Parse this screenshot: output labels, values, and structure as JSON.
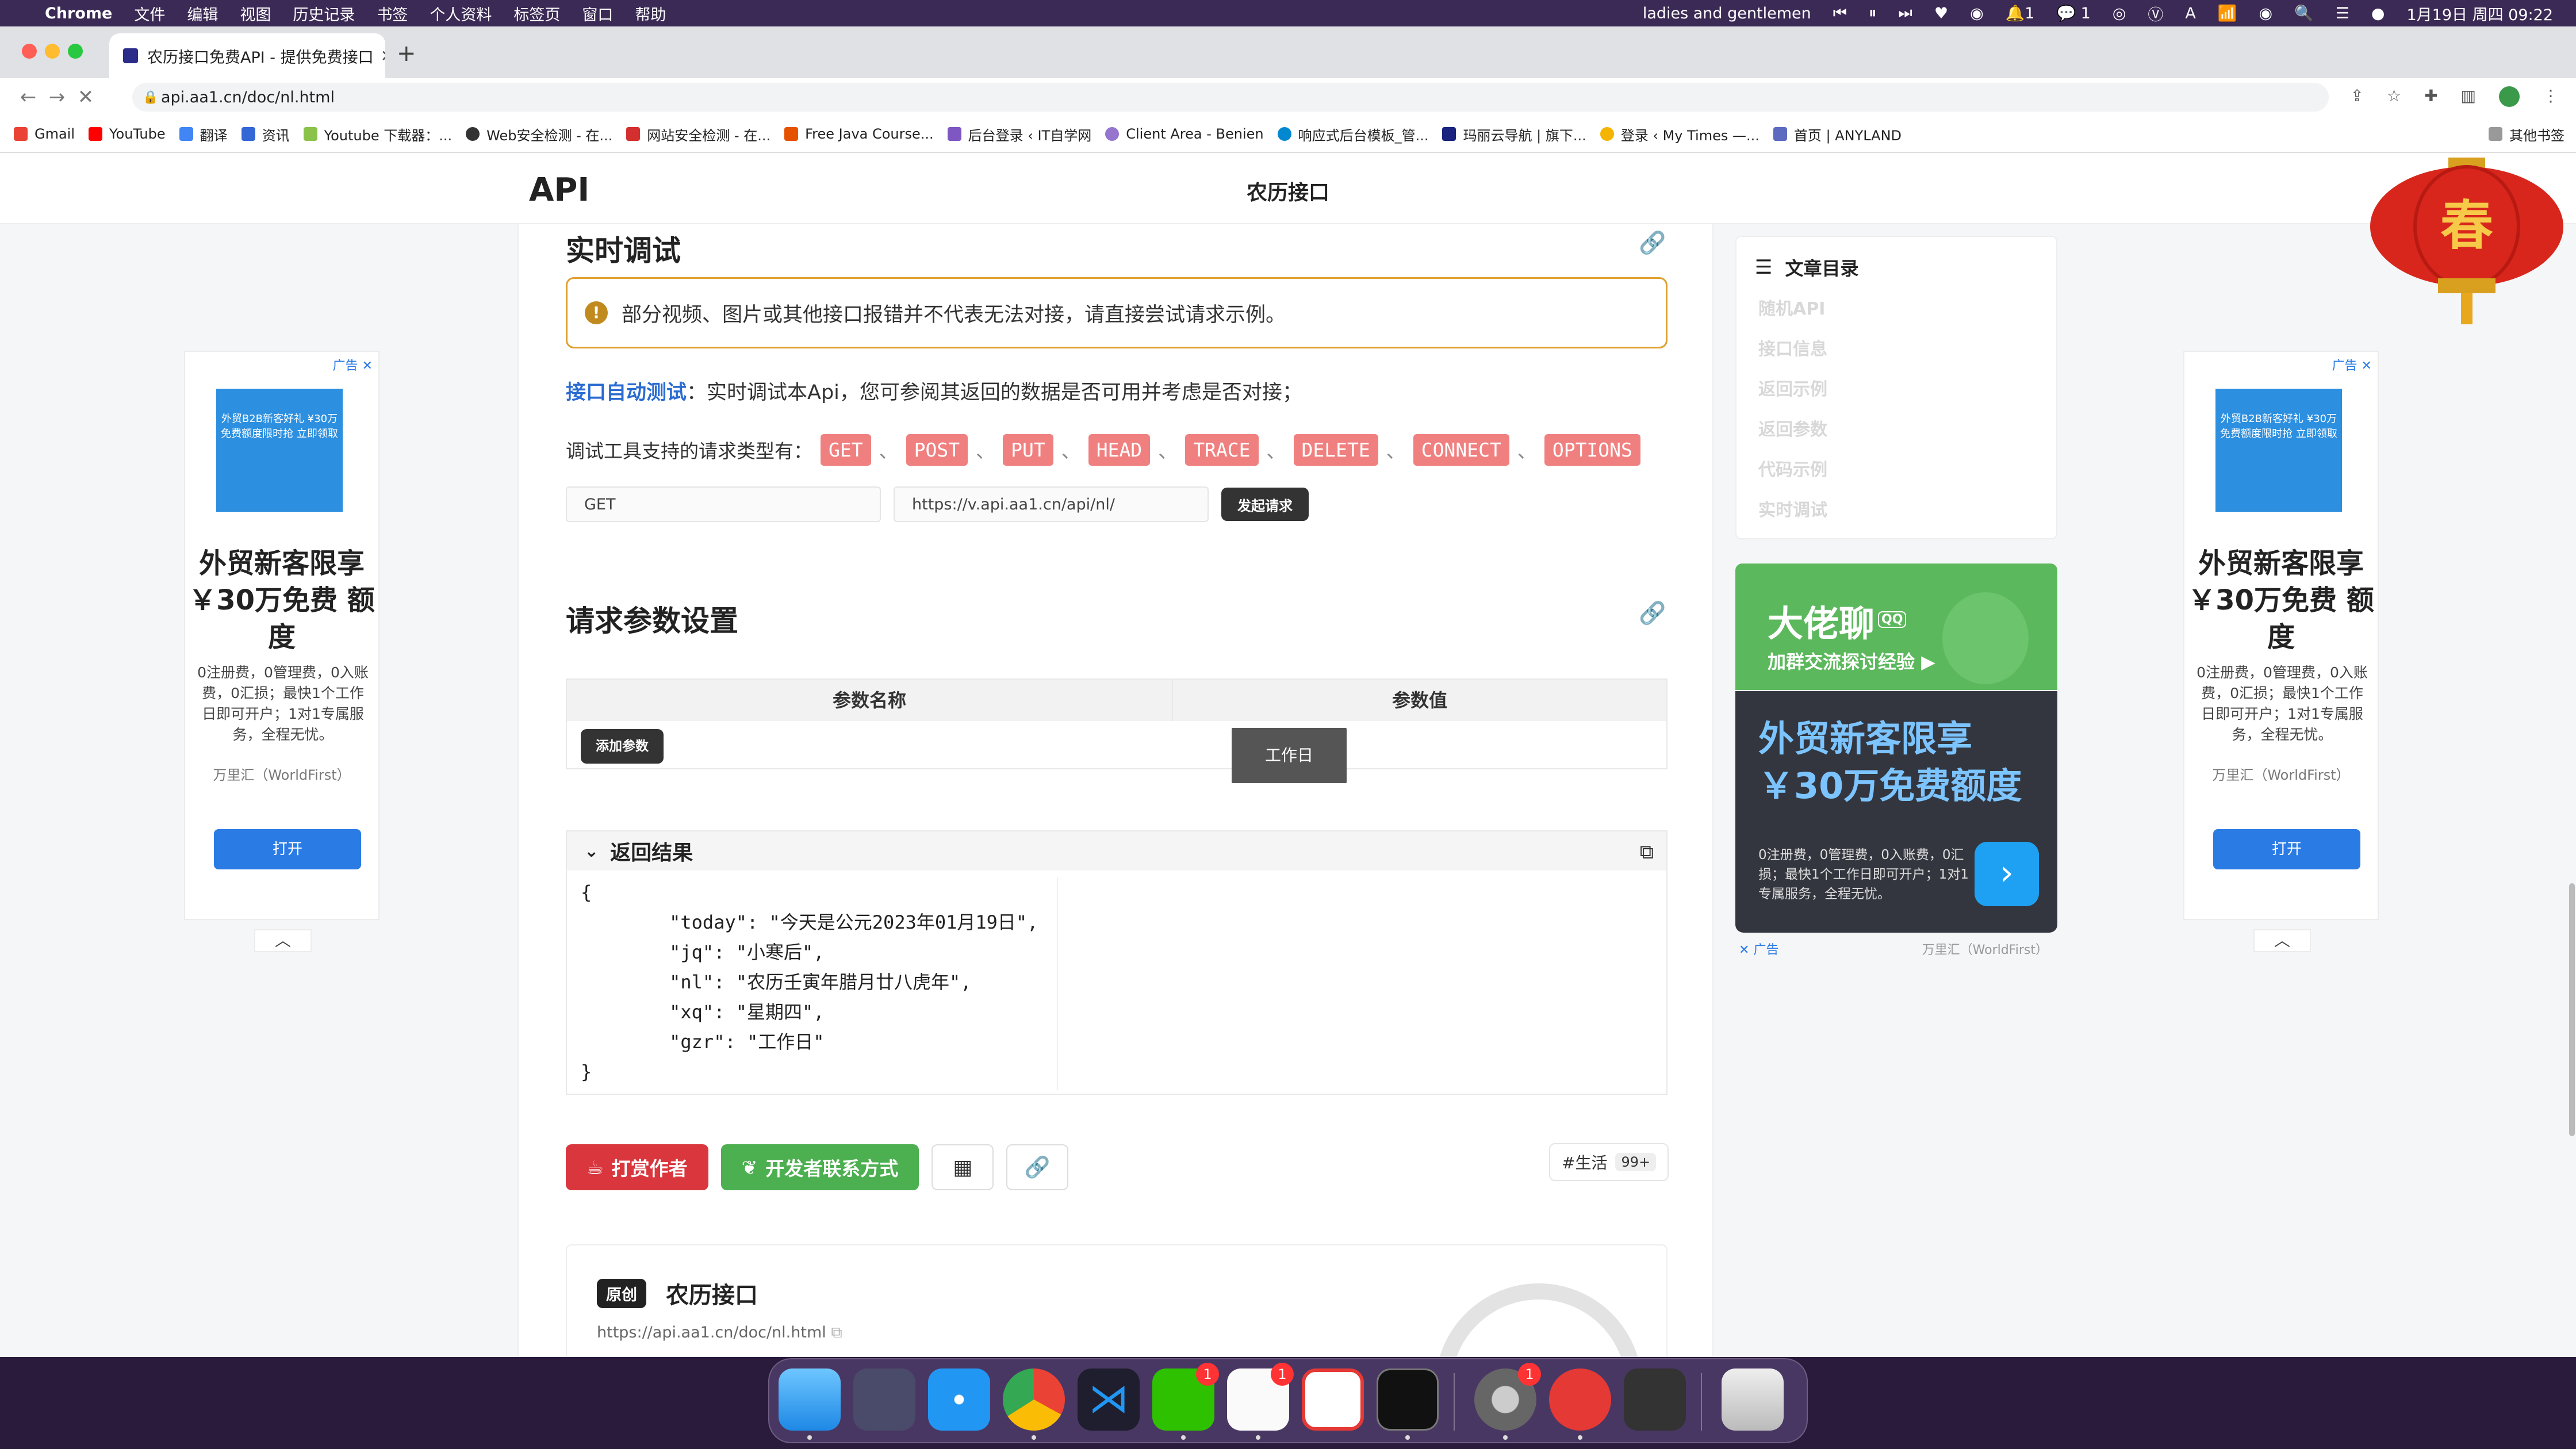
{
  "menubar": {
    "app": "Chrome",
    "items": [
      "文件",
      "编辑",
      "视图",
      "历史记录",
      "书签",
      "个人资料",
      "标签页",
      "窗口",
      "帮助"
    ],
    "now_playing": "ladies and gentlemen",
    "notif_count": "1",
    "wechat_count": "1",
    "datetime": "1月19日 周四  09:22"
  },
  "browser": {
    "tab_title": "农历接口免费API - 提供免费接口",
    "url": "api.aa1.cn/doc/nl.html",
    "bookmarks": [
      "Gmail",
      "YouTube",
      "翻译",
      "资讯",
      "Youtube 下载器：...",
      "Web安全检测 - 在...",
      "网站安全检测 - 在...",
      "Free Java Course...",
      "后台登录 ‹ IT自学网",
      "Client Area - Benien",
      "响应式后台模板_管...",
      "玛丽云导航 | 旗下...",
      "登录 ‹ My Times —...",
      "首页 | ANYLAND"
    ],
    "other_bookmarks": "其他书签"
  },
  "site": {
    "logo": "API",
    "page_title": "农历接口",
    "lantern_char": "春"
  },
  "debug": {
    "heading": "实时调试",
    "notice": "部分视频、图片或其他接口报错并不代表无法对接，请直接尝试请求示例。",
    "autotest_link": "接口自动测试",
    "autotest_text": "：实时调试本Api，您可参阅其返回的数据是否可用并考虑是否对接；",
    "methods_label": "调试工具支持的请求类型有：",
    "methods": [
      "GET",
      "POST",
      "PUT",
      "HEAD",
      "TRACE",
      "DELETE",
      "CONNECT",
      "OPTIONS"
    ],
    "method_value": "GET",
    "url_value": "https://v.api.aa1.cn/api/nl/",
    "send_label": "发起请求"
  },
  "params": {
    "heading": "请求参数设置",
    "col_name": "参数名称",
    "col_value": "参数值",
    "add_label": "添加参数",
    "tooltip": "工作日"
  },
  "result": {
    "heading": "返回结果",
    "code": "{\n        \"today\": \"今天是公元2023年01月19日\",\n        \"jq\": \"小寒后\",\n        \"nl\": \"农历壬寅年腊月廿八虎年\",\n        \"xq\": \"星期四\",\n        \"gzr\": \"工作日\"\n}"
  },
  "actions": {
    "tip_label": "打赏作者",
    "contact_label": "开发者联系方式",
    "tag": "#生活",
    "tag_count": "99+"
  },
  "original": {
    "badge": "原创",
    "title": "农历接口",
    "url": "https://api.aa1.cn/doc/nl.html"
  },
  "side_ad": {
    "tag": "广告",
    "image_text": "外贸B2B新客好礼 ¥30万免费额度限时抢 立即领取",
    "headline": "外贸新客限享 ￥30万免费 额度",
    "body": "0注册费，0管理费，0入账费，0汇损；最快1个工作日即可开户；1对1专属服务，全程无忧。",
    "brand": "万里汇（WorldFirst）",
    "open_label": "打开"
  },
  "toc": {
    "title": "文章目录",
    "items": [
      "随机API",
      "接口信息",
      "返回示例",
      "返回参数",
      "代码示例",
      "实时调试"
    ]
  },
  "qq_ad": {
    "title": "大佬聊",
    "badge": "QQ",
    "subtitle": "加群交流探讨经验 ▶"
  },
  "dark_ad": {
    "headline": "外贸新客限享 ￥30万免费额度",
    "body": "0注册费，0管理费，0入账费，0汇损；最快1个工作日即可开户；1对1专属服务，全程无忧。",
    "tag": "广告",
    "brand": "万里汇（WorldFirst）"
  },
  "dock": {
    "wechat_badge": "1",
    "qq_badge": "1",
    "settings_badge": "1"
  },
  "colors": {
    "accent_blue": "#2b7be5",
    "method_tag": "#f08080",
    "tip_red": "#d9363e",
    "contact_green": "#4caf50",
    "notice_border": "#e0a030"
  }
}
